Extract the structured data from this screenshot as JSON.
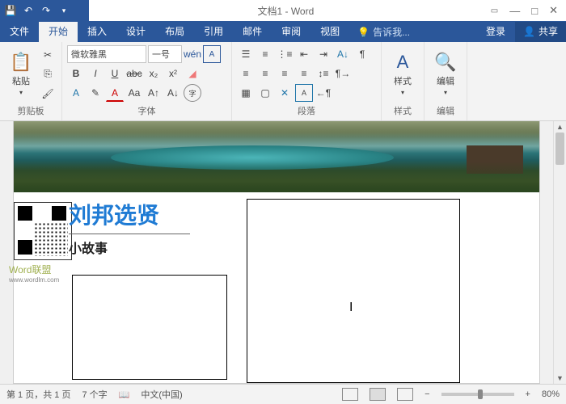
{
  "titlebar": {
    "title": "文档1 - Word"
  },
  "tabs": {
    "file": "文件",
    "home": "开始",
    "insert": "插入",
    "design": "设计",
    "layout": "布局",
    "references": "引用",
    "mailings": "邮件",
    "review": "审阅",
    "view": "视图",
    "tell": "告诉我...",
    "login": "登录",
    "share": "共享"
  },
  "ribbon": {
    "clipboard": {
      "label": "剪贴板",
      "paste": "粘贴"
    },
    "font": {
      "label": "字体",
      "family": "微软雅黑",
      "size": "一号"
    },
    "paragraph": {
      "label": "段落"
    },
    "styles": {
      "label": "样式",
      "btn": "样式"
    },
    "editing": {
      "label": "编辑",
      "btn": "编辑"
    }
  },
  "document": {
    "title1": "刘邦选贤",
    "title2": "小故事",
    "watermark": "Word联盟",
    "watermark_sub": "www.wordlm.com"
  },
  "statusbar": {
    "page": "第 1 页，共 1 页",
    "words": "7 个字",
    "lang": "中文(中国)",
    "zoom": "80%"
  }
}
